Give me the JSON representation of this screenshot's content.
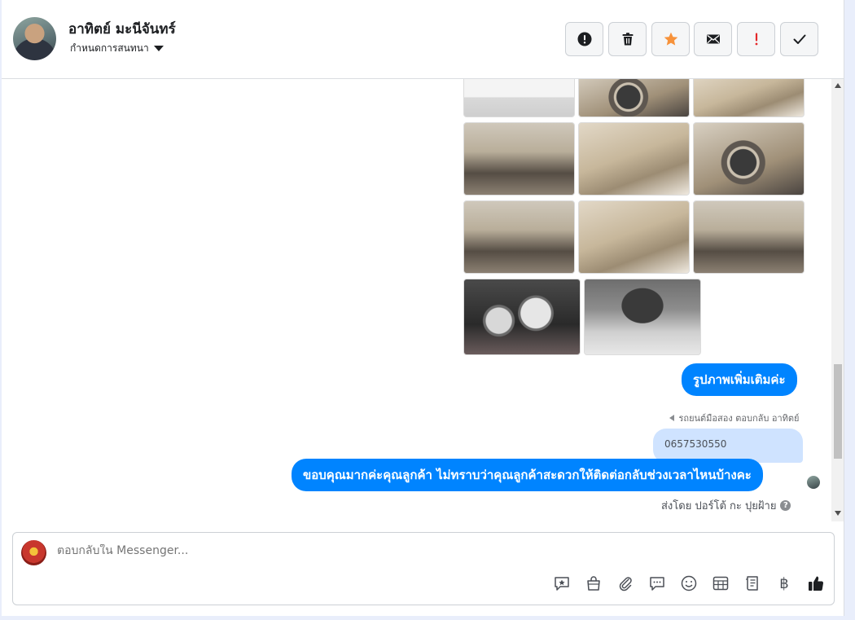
{
  "header": {
    "contact_name": "อาทิตย์ มะนีจันทร์",
    "assign_label": "กำหนดการสนทนา",
    "actions": [
      {
        "name": "report-button",
        "icon": "exclamation-circle-icon"
      },
      {
        "name": "delete-button",
        "icon": "trash-icon"
      },
      {
        "name": "star-button",
        "icon": "star-icon"
      },
      {
        "name": "mark-unread-button",
        "icon": "envelope-icon"
      },
      {
        "name": "mark-important-button",
        "icon": "exclamation-icon"
      },
      {
        "name": "done-button",
        "icon": "checkmark-icon"
      }
    ]
  },
  "thread": {
    "photos": [
      "car-exterior-front",
      "car-wheel",
      "car-door-panel",
      "car-dashboard-left",
      "car-front-seats",
      "car-steering-wheel",
      "car-gear-console",
      "car-rear-seats",
      "car-dashboard-center",
      "car-gauge-cluster",
      "car-engine-bay"
    ],
    "bubble_more_photos": "รูปภาพเพิ่มเติมค่ะ",
    "reply_meta": "รถยนต์มือสอง ตอบกลับ อาทิตย์",
    "quoted_text": "0657530550",
    "bubble_thanks": "ขอบคุณมากค่ะคุณลูกค้า ไม่ทราบว่าคุณลูกค้าสะดวกให้ติดต่อกลับช่วงเวลาไหนบ้างคะ",
    "sent_by": "ส่งโดย ปอร์โต้ กะ ปุยฝ้าย",
    "help_glyph": "?"
  },
  "composer": {
    "placeholder": "ตอบกลับใน Messenger...",
    "baht_glyph": "฿",
    "tools": [
      "saved-reply-icon",
      "shop-bag-icon",
      "attachment-icon",
      "chat-bubble-icon",
      "emoji-icon",
      "table-icon",
      "document-icon",
      "baht-icon",
      "like-icon"
    ]
  },
  "colors": {
    "accent": "#0084ff",
    "quote_bg": "#cfe3ff",
    "star": "#f7923a",
    "important": "#e4282a"
  }
}
